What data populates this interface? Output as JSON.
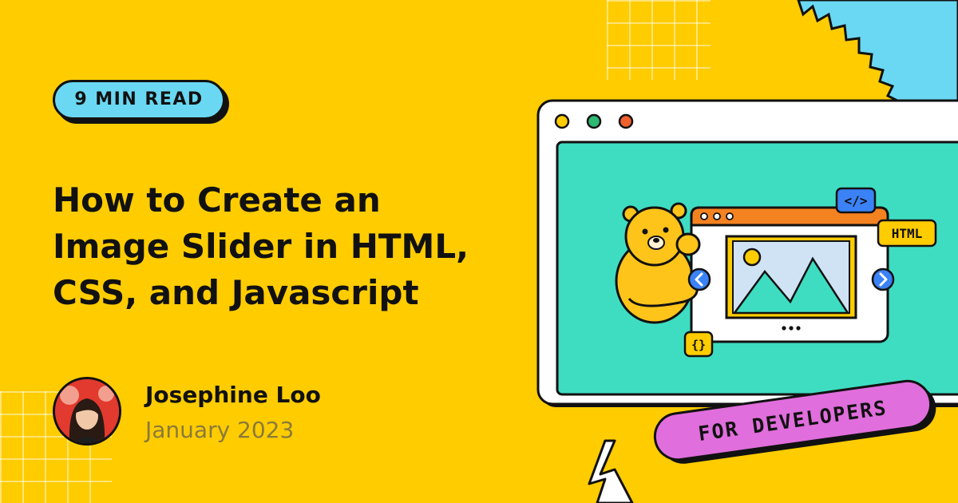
{
  "badge": {
    "label": "9 MIN READ"
  },
  "article": {
    "title_lines": [
      "How to Create an",
      "Image Slider in HTML,",
      "CSS, and Javascript"
    ]
  },
  "author": {
    "name": "Josephine Loo",
    "date": "January 2023"
  },
  "illustration": {
    "code_tag": "</>",
    "html_tag": "HTML",
    "braces_tag": "{}",
    "sticker": "FOR DEVELOPERS",
    "prev_icon": "chevron-left-icon",
    "next_icon": "chevron-right-icon"
  },
  "colors": {
    "background": "#FFCC00",
    "badge": "#6AD8F2",
    "screen": "#3EDDC2",
    "sticker": "#E06EDC",
    "sun": "#6AD8F2",
    "author_date": "#8A7A3A"
  }
}
